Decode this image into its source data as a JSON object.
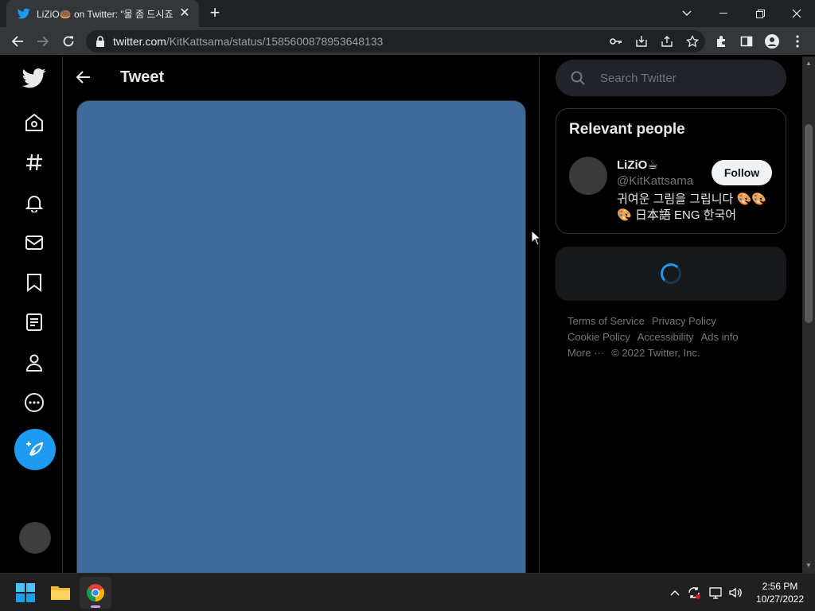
{
  "browser": {
    "tab_title": "LiZiO🍩 on Twitter: \"물 좀 드시죠",
    "tab_close": "✕",
    "new_tab": "+",
    "url_host": "twitter.com",
    "url_path": "/KitKattsama/status/1585600878953648133"
  },
  "nav": {
    "items": [
      "home",
      "explore",
      "notifications",
      "messages",
      "bookmarks",
      "lists",
      "profile",
      "more"
    ]
  },
  "header": {
    "title": "Tweet"
  },
  "search": {
    "placeholder": "Search Twitter"
  },
  "relevant_people": {
    "title": "Relevant people",
    "person": {
      "name": "LiZiO☕",
      "handle": "@KitKattsama",
      "bio": "귀여운 그림을 그립니다 🎨🎨🎨 日本語 ENG 한국어",
      "follow_label": "Follow"
    }
  },
  "footer": {
    "links": [
      "Terms of Service",
      "Privacy Policy",
      "Cookie Policy",
      "Accessibility",
      "Ads info",
      "More ···",
      "© 2022 Twitter, Inc."
    ]
  },
  "taskbar": {
    "time": "2:56 PM",
    "date": "10/27/2022"
  },
  "colors": {
    "accent": "#1d9bf0",
    "media_placeholder": "#3e6b9a"
  }
}
